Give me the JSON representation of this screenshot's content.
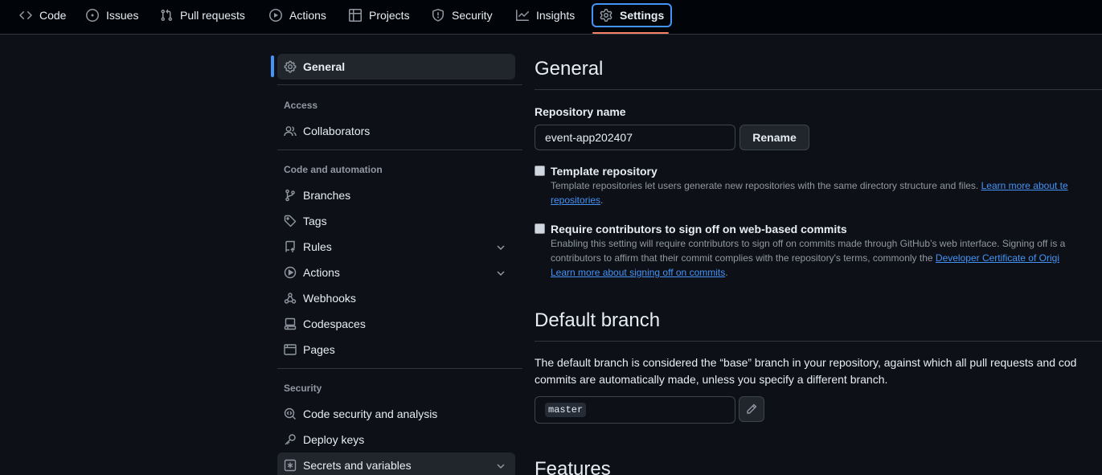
{
  "topnav": {
    "tabs": [
      {
        "label": "Code",
        "icon": "code-icon"
      },
      {
        "label": "Issues",
        "icon": "issue-opened-icon"
      },
      {
        "label": "Pull requests",
        "icon": "git-pull-request-icon"
      },
      {
        "label": "Actions",
        "icon": "play-icon"
      },
      {
        "label": "Projects",
        "icon": "table-icon"
      },
      {
        "label": "Security",
        "icon": "shield-icon"
      },
      {
        "label": "Insights",
        "icon": "graph-icon"
      },
      {
        "label": "Settings",
        "icon": "gear-icon",
        "selected": true
      }
    ]
  },
  "sidebar": {
    "general": "General",
    "access_heading": "Access",
    "collaborators": "Collaborators",
    "code_heading": "Code and automation",
    "branches": "Branches",
    "tags": "Tags",
    "rules": "Rules",
    "actions": "Actions",
    "webhooks": "Webhooks",
    "codespaces": "Codespaces",
    "pages": "Pages",
    "security_heading": "Security",
    "code_security": "Code security and analysis",
    "deploy_keys": "Deploy keys",
    "secrets": "Secrets and variables"
  },
  "main": {
    "title": "General",
    "repo_name_label": "Repository name",
    "repo_name_value": "event-app202407",
    "rename_button": "Rename",
    "template": {
      "title": "Template repository",
      "desc": "Template repositories let users generate new repositories with the same directory structure and files.",
      "link_a": "Learn more about te",
      "link_b": "repositories",
      "tail": "."
    },
    "signoff": {
      "title": "Require contributors to sign off on web-based commits",
      "desc1": "Enabling this setting will require contributors to sign off on commits made through GitHub’s web interface. Signing off is a",
      "desc2": "contributors to affirm that their commit complies with the repository's terms, commonly the",
      "link_dco": "Developer Certificate of Origi",
      "link_learn": "Learn more about signing off on commits",
      "tail": "."
    },
    "default_branch": {
      "title": "Default branch",
      "line1": "The default branch is considered the “base” branch in your repository, against which all pull requests and cod",
      "line2": "commits are automatically made, unless you specify a different branch.",
      "branch": "master"
    },
    "features_title": "Features"
  },
  "colors": {
    "background": "#0d1117",
    "accent": "#4493f8",
    "underline": "#f78166",
    "border": "#30363d",
    "muted": "#9198a1"
  }
}
